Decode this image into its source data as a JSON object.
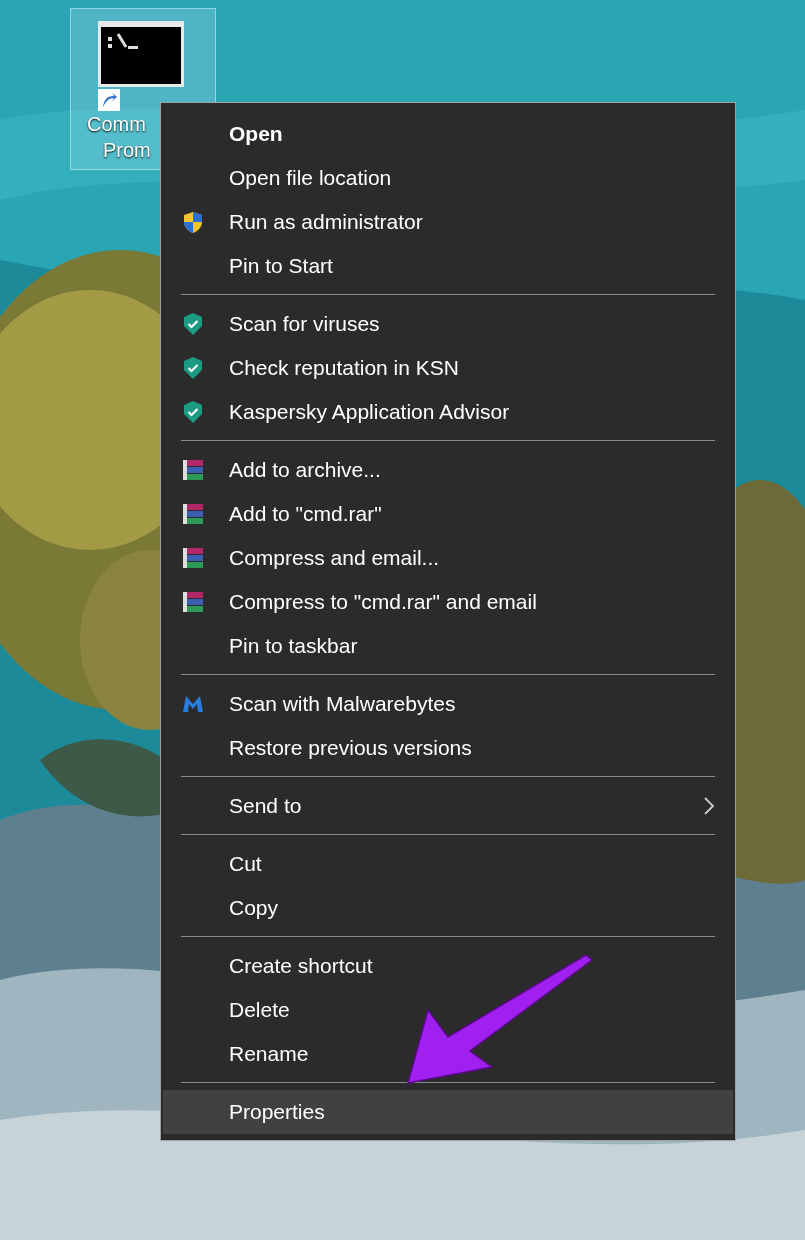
{
  "desktop_icon": {
    "label_lines": [
      "Comm",
      "Prom"
    ],
    "selected": true
  },
  "context_menu": {
    "items": [
      {
        "kind": "plain",
        "label": "Open",
        "default": true,
        "submenu": false,
        "selected": false
      },
      {
        "kind": "plain",
        "label": "Open file location",
        "default": false,
        "submenu": false,
        "selected": false
      },
      {
        "kind": "admin",
        "label": "Run as administrator",
        "default": false,
        "submenu": false,
        "selected": false
      },
      {
        "kind": "plain",
        "label": "Pin to Start",
        "default": false,
        "submenu": false,
        "selected": false
      },
      {
        "kind": "separator"
      },
      {
        "kind": "antivirus",
        "label": "Scan for viruses",
        "default": false,
        "submenu": false,
        "selected": false
      },
      {
        "kind": "antivirus",
        "label": "Check reputation in KSN",
        "default": false,
        "submenu": false,
        "selected": false
      },
      {
        "kind": "antivirus",
        "label": "Kaspersky Application Advisor",
        "default": false,
        "submenu": false,
        "selected": false
      },
      {
        "kind": "separator"
      },
      {
        "kind": "archive",
        "label": "Add to archive...",
        "default": false,
        "submenu": false,
        "selected": false
      },
      {
        "kind": "archive",
        "label": "Add to \"cmd.rar\"",
        "default": false,
        "submenu": false,
        "selected": false
      },
      {
        "kind": "archive",
        "label": "Compress and email...",
        "default": false,
        "submenu": false,
        "selected": false
      },
      {
        "kind": "archive",
        "label": "Compress to \"cmd.rar\" and email",
        "default": false,
        "submenu": false,
        "selected": false
      },
      {
        "kind": "plain",
        "label": "Pin to taskbar",
        "default": false,
        "submenu": false,
        "selected": false
      },
      {
        "kind": "separator"
      },
      {
        "kind": "malware",
        "label": "Scan with Malwarebytes",
        "default": false,
        "submenu": false,
        "selected": false
      },
      {
        "kind": "plain",
        "label": "Restore previous versions",
        "default": false,
        "submenu": false,
        "selected": false
      },
      {
        "kind": "separator"
      },
      {
        "kind": "plain",
        "label": "Send to",
        "default": false,
        "submenu": true,
        "selected": false
      },
      {
        "kind": "separator"
      },
      {
        "kind": "plain",
        "label": "Cut",
        "default": false,
        "submenu": false,
        "selected": false
      },
      {
        "kind": "plain",
        "label": "Copy",
        "default": false,
        "submenu": false,
        "selected": false
      },
      {
        "kind": "separator"
      },
      {
        "kind": "plain",
        "label": "Create shortcut",
        "default": false,
        "submenu": false,
        "selected": false
      },
      {
        "kind": "plain",
        "label": "Delete",
        "default": false,
        "submenu": false,
        "selected": false
      },
      {
        "kind": "plain",
        "label": "Rename",
        "default": false,
        "submenu": false,
        "selected": false
      },
      {
        "kind": "separator"
      },
      {
        "kind": "plain",
        "label": "Properties",
        "default": false,
        "submenu": false,
        "selected": true
      }
    ]
  }
}
